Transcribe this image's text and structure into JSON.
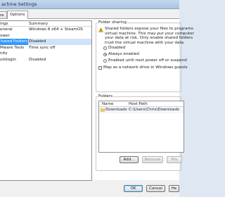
{
  "window": {
    "title": "achine Settings"
  },
  "tabs": [
    {
      "label": "re",
      "active": false
    },
    {
      "label": "Options",
      "active": true
    }
  ],
  "settings_list": {
    "headers": [
      "ings",
      "Summary"
    ],
    "rows": [
      {
        "setting": "eneral",
        "summary": "Windows 8 x64 + SteamOS"
      },
      {
        "setting": "ower",
        "summary": ""
      },
      {
        "setting": "hared Folders",
        "summary": "Disabled",
        "selected": true
      },
      {
        "setting": "Mware Tools",
        "summary": "Time sync off"
      },
      {
        "setting": "nity",
        "summary": ""
      },
      {
        "setting": "utologin",
        "summary": "Disabled"
      }
    ]
  },
  "folder_sharing": {
    "title": "Folder sharing",
    "description": [
      "Shared folders expose your files to programs",
      "virtual machine. This may put your computer",
      "your data at risk. Only enable shared folders",
      "trust the virtual machine with your data."
    ],
    "options": [
      {
        "label": "Disabled",
        "selected": false
      },
      {
        "label": "Always enabled",
        "selected": true
      },
      {
        "label": "Enabled until next power off or suspend",
        "selected": false
      }
    ],
    "map_drive_label": "Map as a network drive in Windows guests",
    "map_drive_checked": false
  },
  "folders": {
    "title": "Folders",
    "headers": [
      "Name",
      "Host Path"
    ],
    "rows": [
      {
        "name": "Downloads",
        "path": "C:\\Users\\Chris\\Downloads",
        "checked": true
      }
    ],
    "buttons": {
      "add": "Add...",
      "remove": "Remove",
      "properties": "Pro"
    }
  },
  "footer": {
    "ok": "OK",
    "cancel": "Cancel",
    "help": "He"
  },
  "colors": {
    "selection": "#3399ff",
    "warning": "#f0c419"
  },
  "icons": {
    "warning": "warning-icon",
    "folder": "folder-icon"
  }
}
